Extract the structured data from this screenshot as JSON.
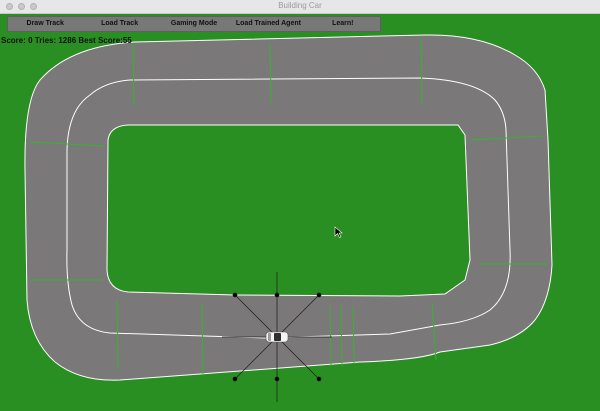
{
  "window": {
    "title": "Building Car"
  },
  "toolbar": {
    "buttons": [
      {
        "label": "Draw Track"
      },
      {
        "label": "Load Track"
      },
      {
        "label": "Gaming Mode"
      },
      {
        "label": "Load Trained Agent"
      },
      {
        "label": "Learn!"
      }
    ]
  },
  "hud": {
    "text": "Score: 0 Tries: 1286 Best Score:55"
  },
  "colors": {
    "grass": "#2a8f22",
    "track": "#7a7878",
    "edge": "#ffffff",
    "checkpoint": "#35b52c",
    "sensor": "#000000"
  },
  "icons": [
    "close-icon",
    "minimize-icon",
    "zoom-icon",
    "car-icon",
    "mouse-cursor-icon"
  ]
}
